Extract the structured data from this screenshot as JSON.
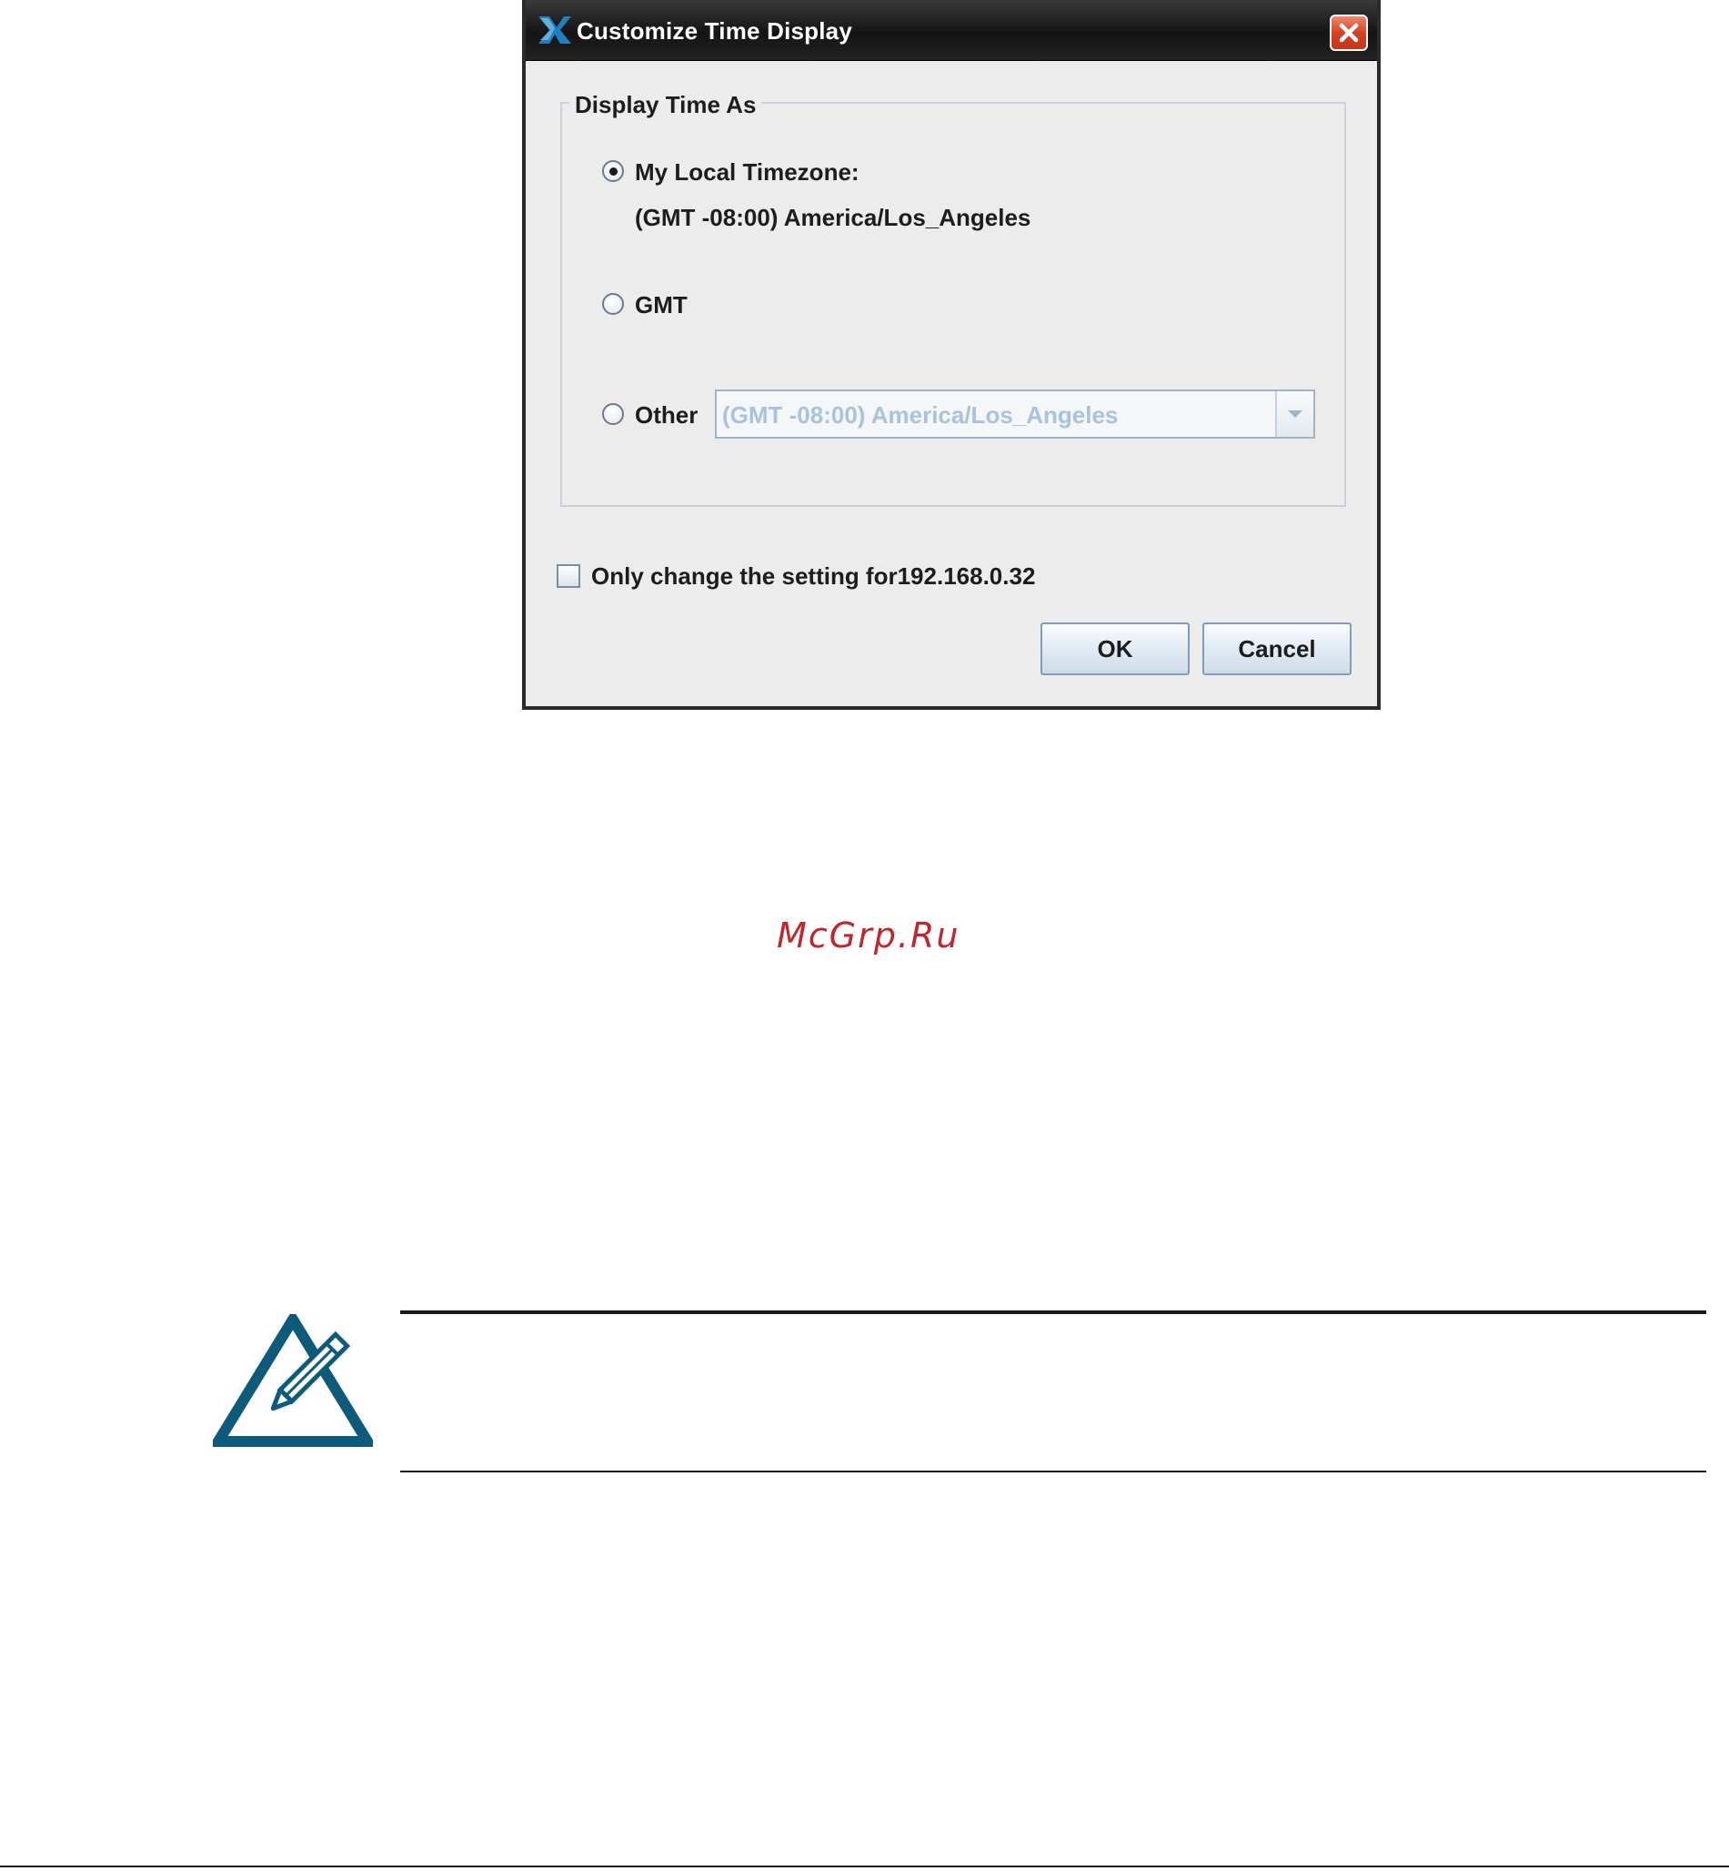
{
  "dialog": {
    "title": "Customize Time Display",
    "close_icon": "close-icon",
    "app_icon": "app-logo-icon"
  },
  "group": {
    "legend": "Display Time As",
    "options": {
      "local": {
        "label": "My Local Timezone:",
        "detail": "(GMT -08:00) America/Los_Angeles",
        "selected": true
      },
      "gmt": {
        "label": "GMT",
        "selected": false
      },
      "other": {
        "label": "Other",
        "selected": false,
        "combo_value": "(GMT -08:00) America/Los_Angeles",
        "combo_disabled": true
      }
    }
  },
  "checkbox": {
    "label": "Only change the setting for192.168.0.32",
    "checked": false
  },
  "buttons": {
    "ok": "OK",
    "cancel": "Cancel"
  },
  "watermark": "McGrp.Ru",
  "note": {
    "icon": "note-pencil-icon"
  },
  "colors": {
    "note_icon": "#0e5a7a",
    "watermark": "#c0262b",
    "close_button": "#d4421f"
  }
}
